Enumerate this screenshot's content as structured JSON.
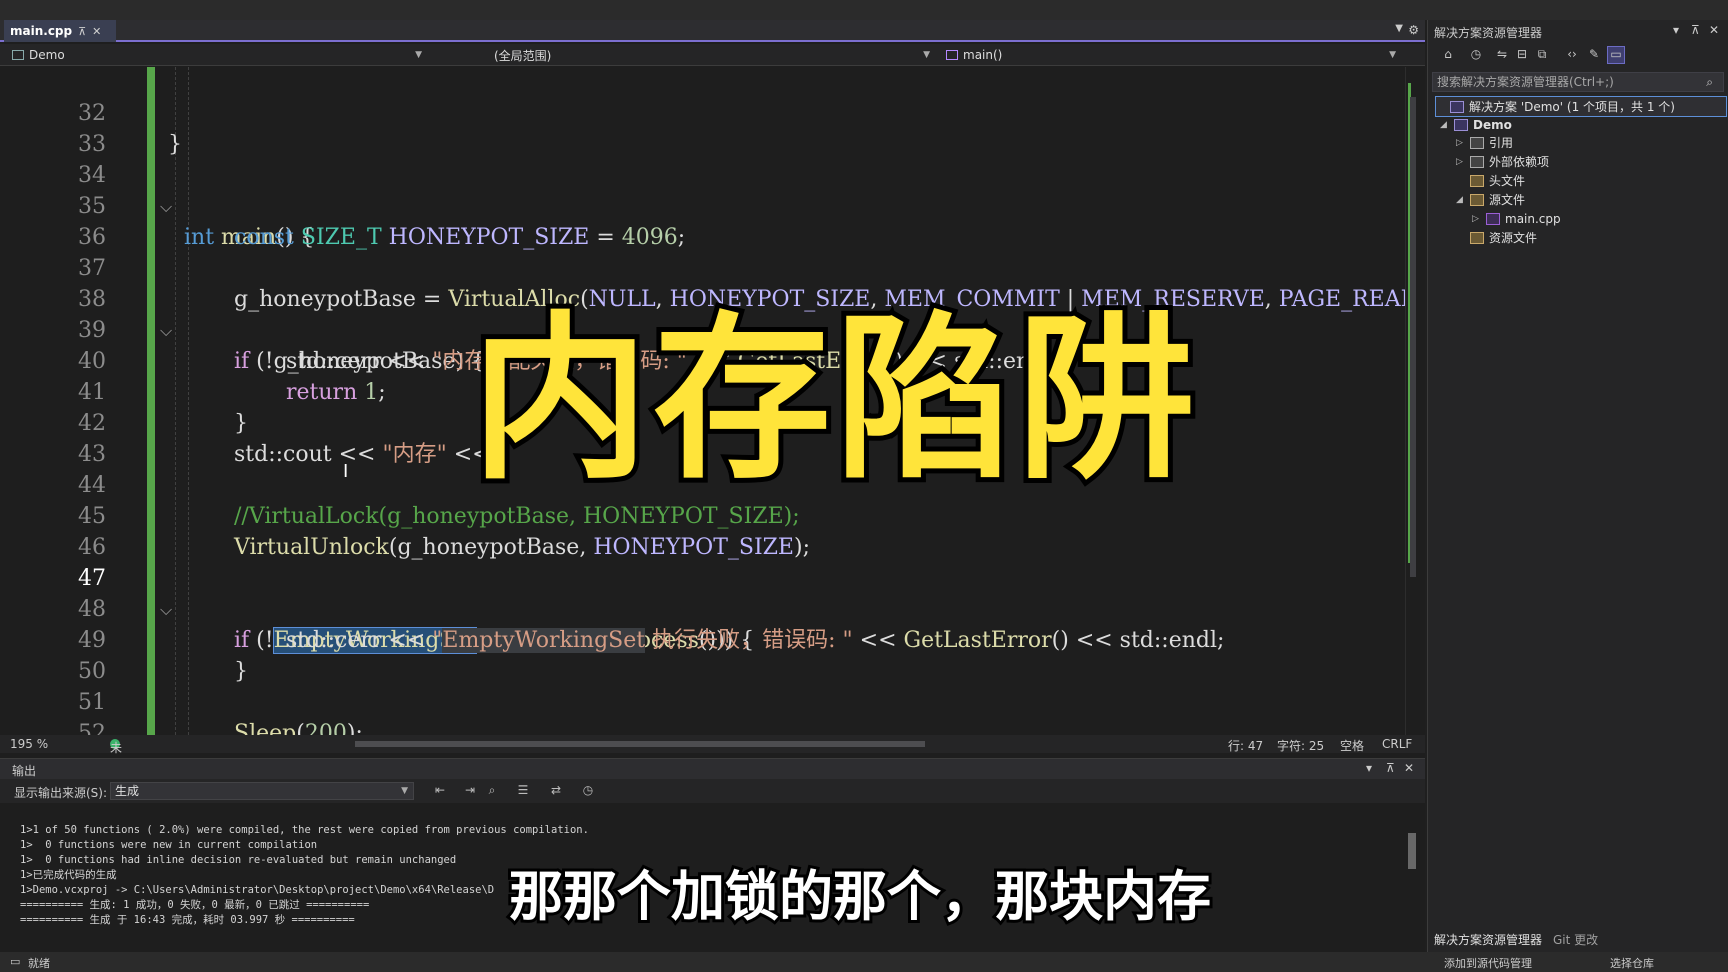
{
  "editor": {
    "tab": {
      "title": "main.cpp",
      "pin": "⊼",
      "close": "✕"
    },
    "nav": {
      "project": "Demo",
      "scope": "(全局范围)",
      "member": "main()"
    },
    "lines": [
      {
        "n": "32"
      },
      {
        "n": "33"
      },
      {
        "n": "34"
      },
      {
        "n": "35"
      },
      {
        "n": "36"
      },
      {
        "n": "37"
      },
      {
        "n": "38"
      },
      {
        "n": "39"
      },
      {
        "n": "40"
      },
      {
        "n": "41"
      },
      {
        "n": "42"
      },
      {
        "n": "43"
      },
      {
        "n": "44"
      },
      {
        "n": "45"
      },
      {
        "n": "46"
      },
      {
        "n": "47"
      },
      {
        "n": "48"
      },
      {
        "n": "49"
      },
      {
        "n": "50"
      },
      {
        "n": "51"
      },
      {
        "n": "52"
      }
    ],
    "code": {
      "l32": "}",
      "l34_kw": "int",
      "l34_fn": "main",
      "l34_rest": "() {",
      "l35_kw": "const",
      "l35_ty": "SIZE_T",
      "l35_var": "HONEYPOT_SIZE",
      "l35_eq": " = ",
      "l35_num": "4096",
      "l35_end": ";",
      "l37_var": "g_honeypotBase",
      "l37_eq": " = ",
      "l37_fn": "VirtualAlloc",
      "l37_p1": "(",
      "l37_a1": "NULL",
      "l37_c1": ", ",
      "l37_a2": "HONEYPOT_SIZE",
      "l37_c2": ", ",
      "l37_a3": "MEM_COMMIT",
      "l37_or": " | ",
      "l37_a4": "MEM_RESERVE",
      "l37_c3": ", ",
      "l37_a5": "PAGE_READWRITE",
      "l38_kw": "if",
      "l38_rest": " (!g_honeypotBase) {",
      "l39_a": "std::cerr << ",
      "l39_str": "\"内存分配失败，错误码: \"",
      "l39_b": " << ",
      "l39_fn": "GetLastError",
      "l39_c": "() << std::endl",
      "l40_kw": "return",
      "l40_num": " 1",
      "l40_end": ";",
      "l41": "}",
      "l42_a": "std::cout << ",
      "l42_str": "\"内存\"",
      "l42_b": " << ",
      "l44_cmt": "//VirtualLock(g_honeypotBase, HONEYPOT_SIZE);",
      "l45_fn": "VirtualUnlock",
      "l45_rest": "(g_honeypotBase, ",
      "l45_mac": "HONEYPOT_SIZE",
      "l45_end": ");",
      "l47_kw": "if",
      "l47_a": " (!",
      "l47_sel": "EmptyWorkingSet",
      "l47_b": "(",
      "l47_fn": "GetCurrentProcess",
      "l47_c": "())) {",
      "l48_a": "std::cerr << ",
      "l48_q": "\"",
      "l48_hl": "EmptyWorkingSet",
      "l48_str": " 执行失败，错误码: \"",
      "l48_b": " << ",
      "l48_fn": "GetLastError",
      "l48_c": "() << std::endl;",
      "l49": "}",
      "l51_fn": "Sleep",
      "l51_a": "(",
      "l51_num": "200",
      "l51_b": ");"
    },
    "status": {
      "zoom": "195 %",
      "issues": "未找到相关问题",
      "line": "行: 47",
      "col": "字符: 25",
      "ws": "空格",
      "eol": "CRLF"
    }
  },
  "output": {
    "title": "输出",
    "source_label": "显示输出来源(S):",
    "source_value": "生成",
    "lines": [
      "1>1 of 50 functions ( 2.0%) were compiled, the rest were copied from previous compilation.",
      "1>  0 functions were new in current compilation",
      "1>  0 functions had inline decision re-evaluated but remain unchanged",
      "1>已完成代码的生成",
      "1>Demo.vcxproj -> C:\\Users\\Administrator\\Desktop\\project\\Demo\\x64\\Release\\D",
      "========== 生成: 1 成功，0 失败，0 最新，0 已跳过 ==========",
      "========== 生成 于 16:43 完成，耗时 03.997 秒 =========="
    ]
  },
  "solution": {
    "title": "解决方案资源管理器",
    "search_placeholder": "搜索解决方案资源管理器(Ctrl+;)",
    "tree": [
      {
        "label": "解决方案 'Demo' (1 个项目，共 1 个)",
        "icon": "solution-icon"
      },
      {
        "label": "Demo",
        "icon": "project-icon"
      },
      {
        "label": "引用",
        "icon": "references-icon"
      },
      {
        "label": "外部依赖项",
        "icon": "external-deps-icon"
      },
      {
        "label": "头文件",
        "icon": "folder-icon"
      },
      {
        "label": "源文件",
        "icon": "folder-icon"
      },
      {
        "label": "main.cpp",
        "icon": "cpp-file-icon"
      },
      {
        "label": "资源文件",
        "icon": "folder-icon"
      }
    ],
    "bottom_tabs": [
      "解决方案资源管理器",
      "Git 更改"
    ]
  },
  "bottombar": {
    "left": "就绪",
    "git": "添加到源代码管理",
    "repo": "选择仓库"
  },
  "overlay": {
    "title": "内存陷阱",
    "subtitle": "那那个加锁的那个，那块内存"
  },
  "colors": {
    "keyword": "#569cd6",
    "type": "#4ec9b0",
    "macro": "#beb7ff",
    "number": "#b5cea8",
    "string": "#d69d85",
    "comment": "#57a64a",
    "function": "#dcdcaa",
    "title_yellow": "#ffe43a"
  }
}
